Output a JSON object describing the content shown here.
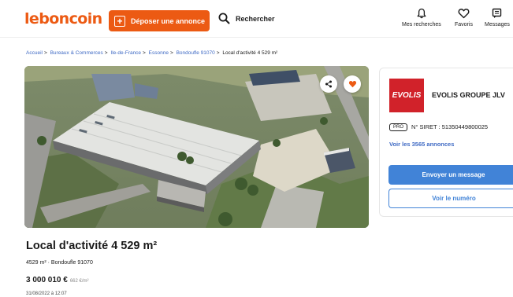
{
  "header": {
    "logo": "leboncoin",
    "post_button": "Déposer une annonce",
    "search_label": "Rechercher",
    "nav": [
      {
        "label": "Mes recherches",
        "icon": "bell-icon"
      },
      {
        "label": "Favoris",
        "icon": "heart-icon"
      },
      {
        "label": "Messages",
        "icon": "message-icon"
      }
    ]
  },
  "breadcrumb": {
    "links": [
      "Accueil",
      "Bureaux & Commerces",
      "Ile-de-France",
      "Essonne",
      "Bondoufle 91070"
    ],
    "current": "Local d'activité 4 529 m²",
    "separator": ">"
  },
  "photo": {
    "share_icon": "share-icon",
    "favorite_icon": "heart-icon"
  },
  "seller": {
    "logo_text": "EVOLIS",
    "name": "EVOLIS GROUPE JLV",
    "badge": "PRO",
    "siret": "N° SIRET : 51350449800025",
    "ads_link": "Voir les 3565 annonces",
    "message_button": "Envoyer un message",
    "phone_button": "Voir le numéro"
  },
  "listing": {
    "title": "Local d'activité 4 529 m²",
    "subtitle": "4529 m² · Bondoufle 91070",
    "price": "3 000 010 €",
    "price_per_sqm": "662 €/m²",
    "date": "31/08/2022 à 12:07"
  },
  "colors": {
    "brand_orange": "#ec5a13",
    "link_blue": "#3f6ac4",
    "button_blue": "#4183d7",
    "evolis_red": "#d1222a"
  }
}
